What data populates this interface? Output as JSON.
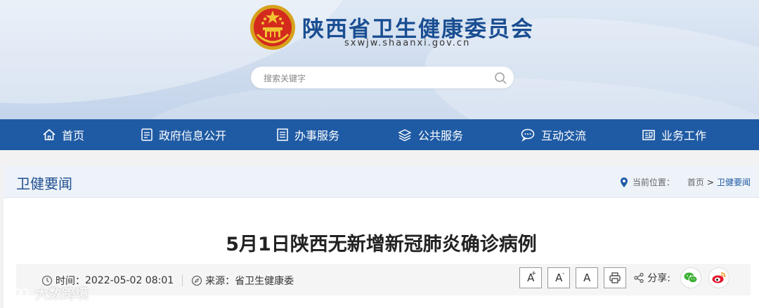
{
  "header": {
    "site_title": "陕西省卫生健康委员会",
    "site_domain": "sxwjw.shaanxi.gov.cn",
    "search_placeholder": "搜索关键字"
  },
  "nav": {
    "items": [
      {
        "label": "首页",
        "icon": "home-icon"
      },
      {
        "label": "政府信息公开",
        "icon": "document-icon"
      },
      {
        "label": "办事服务",
        "icon": "form-icon"
      },
      {
        "label": "公共服务",
        "icon": "layers-icon"
      },
      {
        "label": "互动交流",
        "icon": "chat-icon"
      },
      {
        "label": "业务工作",
        "icon": "briefcase-icon"
      }
    ]
  },
  "section": {
    "title": "卫健要闻",
    "breadcrumb": {
      "label": "当前位置：",
      "home": "首页",
      "separator": ">",
      "current": "卫健要闻"
    }
  },
  "article": {
    "title": "5月1日陕西无新增新冠肺炎确诊病例",
    "time_label": "时间：",
    "time": "2022-05-02 08:01",
    "source_label": "来源：",
    "source": "省卫生健康委"
  },
  "tools": {
    "font_large": "A",
    "font_large_mark": "+",
    "font_small": "A",
    "font_small_mark": "-",
    "font_reset": "A",
    "share_label": "分享:"
  },
  "watermark": "大数跨境",
  "colors": {
    "nav_bg": "#1f5ba4",
    "title_blue": "#1a4e92",
    "wechat_green": "#3cb034",
    "weibo_red": "#e6162d"
  }
}
